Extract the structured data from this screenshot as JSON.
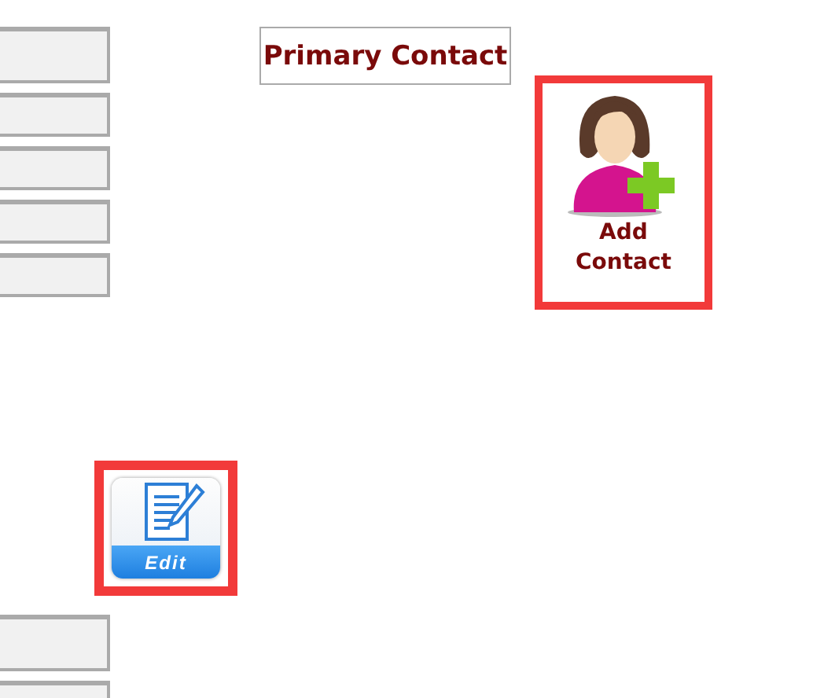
{
  "top_fields": [
    {
      "kind": "text"
    },
    {
      "kind": "text"
    },
    {
      "kind": "text"
    },
    {
      "kind": "text"
    },
    {
      "kind": "text"
    }
  ],
  "primary_contact": {
    "title": "Primary Contact"
  },
  "add_contact": {
    "label": "Add Contact"
  },
  "edit": {
    "label": "Edit"
  },
  "bottom_fields": [
    {
      "kind": "text"
    },
    {
      "kind": "text"
    }
  ]
}
